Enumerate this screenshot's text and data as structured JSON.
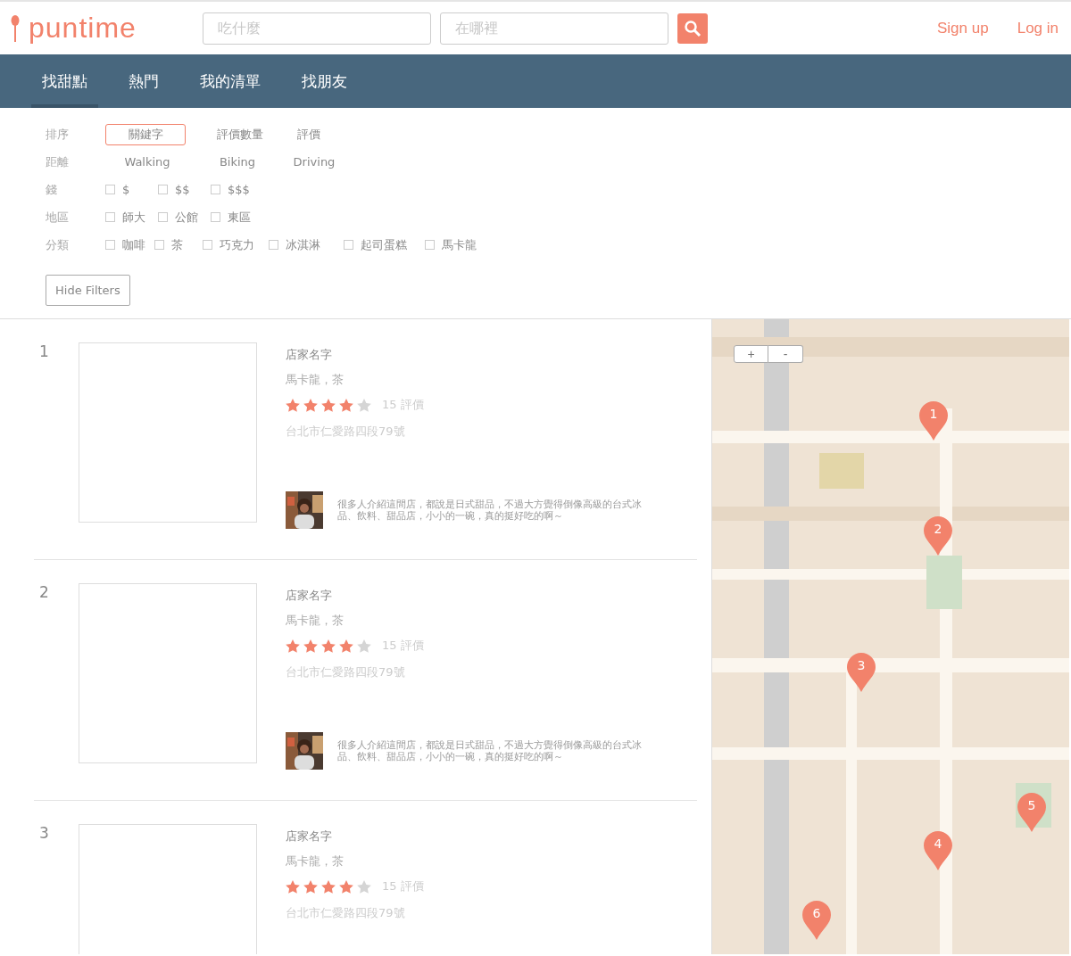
{
  "header": {
    "logo": "puntime",
    "search_what": {
      "placeholder": "吃什麼"
    },
    "search_where": {
      "placeholder": "在哪裡"
    },
    "links": [
      "Sign up",
      "Log in"
    ]
  },
  "nav": [
    {
      "label": "找甜點",
      "selected": true
    },
    {
      "label": "熱門",
      "selected": false
    },
    {
      "label": "我的清單",
      "selected": false
    },
    {
      "label": "找朋友",
      "selected": false
    }
  ],
  "filters": [
    {
      "label": "排序",
      "kind": "choice",
      "options": [
        {
          "label": "關鍵字",
          "selected": true
        },
        {
          "label": "評價數量",
          "selected": false
        },
        {
          "label": "評價",
          "selected": false
        }
      ]
    },
    {
      "label": "距離",
      "kind": "mode",
      "options": [
        {
          "label": "Walking"
        },
        {
          "label": "Biking"
        },
        {
          "label": "Driving"
        }
      ]
    },
    {
      "label": "錢",
      "kind": "check",
      "options": [
        {
          "label": "$",
          "checked": false
        },
        {
          "label": "$$",
          "checked": false
        },
        {
          "label": "$$$",
          "checked": false
        }
      ]
    },
    {
      "label": "地區",
      "kind": "check",
      "options": [
        {
          "label": "師大",
          "checked": false
        },
        {
          "label": "公館",
          "checked": false
        },
        {
          "label": "東區",
          "checked": false
        }
      ]
    },
    {
      "label": "分類",
      "kind": "check",
      "options": [
        {
          "label": "咖啡",
          "checked": false
        },
        {
          "label": "茶",
          "checked": false
        },
        {
          "label": "巧克力",
          "checked": false
        },
        {
          "label": "冰淇淋",
          "checked": false
        },
        {
          "label": "起司蛋糕",
          "checked": false
        },
        {
          "label": "馬卡龍",
          "checked": false
        }
      ]
    }
  ],
  "hide_filters": "Hide Filters",
  "results": [
    {
      "rank": "1",
      "name": "店家名字",
      "tags": "馬卡龍，茶",
      "stars": 4,
      "reviews": "15 評價",
      "address": "台北市仁愛路四段79號",
      "review": "很多人介紹這間店，都說是日式甜品，不過大方覺得倒像高級的台式冰品、飲料、甜品店，小小的一碗，真的挺好吃的啊～"
    },
    {
      "rank": "2",
      "name": "店家名字",
      "tags": "馬卡龍，茶",
      "stars": 4,
      "reviews": "15 評價",
      "address": "台北市仁愛路四段79號",
      "review": "很多人介紹這間店，都說是日式甜品，不過大方覺得倒像高級的台式冰品、飲料、甜品店，小小的一碗，真的挺好吃的啊～"
    },
    {
      "rank": "3",
      "name": "店家名字",
      "tags": "馬卡龍，茶",
      "stars": 4,
      "reviews": "15 評價",
      "address": "台北市仁愛路四段79號"
    }
  ],
  "map": {
    "zoom_in": "+",
    "zoom_out": "-",
    "pins": [
      "1",
      "2",
      "3",
      "4",
      "5",
      "6"
    ]
  }
}
